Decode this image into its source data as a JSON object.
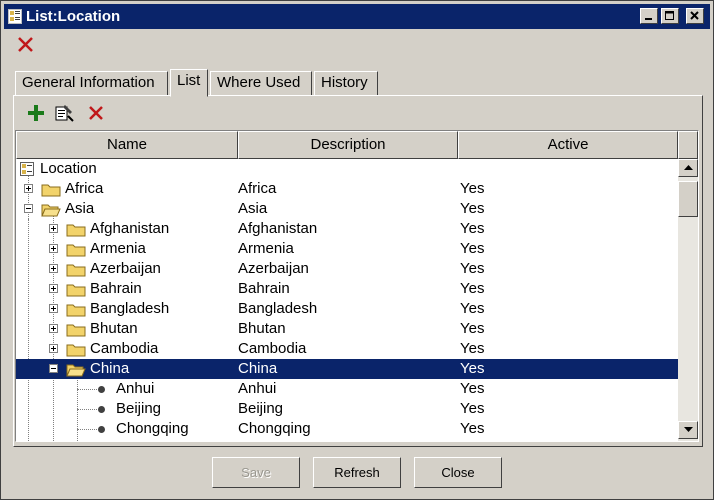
{
  "window": {
    "title": "List:Location"
  },
  "tabs": [
    {
      "label": "General Information"
    },
    {
      "label": "List"
    },
    {
      "label": "Where Used"
    },
    {
      "label": "History"
    }
  ],
  "columns": {
    "name": "Name",
    "description": "Description",
    "active": "Active"
  },
  "tree": {
    "root_label": "Location",
    "rows": [
      {
        "name": "Africa",
        "description": "Africa",
        "active": "Yes"
      },
      {
        "name": "Asia",
        "description": "Asia",
        "active": "Yes"
      },
      {
        "name": "Afghanistan",
        "description": "Afghanistan",
        "active": "Yes"
      },
      {
        "name": "Armenia",
        "description": "Armenia",
        "active": "Yes"
      },
      {
        "name": "Azerbaijan",
        "description": "Azerbaijan",
        "active": "Yes"
      },
      {
        "name": "Bahrain",
        "description": "Bahrain",
        "active": "Yes"
      },
      {
        "name": "Bangladesh",
        "description": "Bangladesh",
        "active": "Yes"
      },
      {
        "name": "Bhutan",
        "description": "Bhutan",
        "active": "Yes"
      },
      {
        "name": "Cambodia",
        "description": "Cambodia",
        "active": "Yes"
      },
      {
        "name": "China",
        "description": "China",
        "active": "Yes"
      },
      {
        "name": "Anhui",
        "description": "Anhui",
        "active": "Yes"
      },
      {
        "name": "Beijing",
        "description": "Beijing",
        "active": "Yes"
      },
      {
        "name": "Chongqing",
        "description": "Chongqing",
        "active": "Yes"
      }
    ]
  },
  "buttons": {
    "save": "Save",
    "refresh": "Refresh",
    "close": "Close"
  },
  "colors": {
    "titlebar": "#0a246a",
    "selection": "#0a246a",
    "chrome": "#d4d0c8",
    "add_icon": "#1a7a1a",
    "delete_icon": "#c0181a"
  },
  "icons": {
    "title": "list-window-icon",
    "top_delete": "close-x-icon",
    "add": "plus-icon",
    "edit": "edit-properties-icon",
    "delete": "delete-x-icon",
    "folder": "folder-icon"
  }
}
